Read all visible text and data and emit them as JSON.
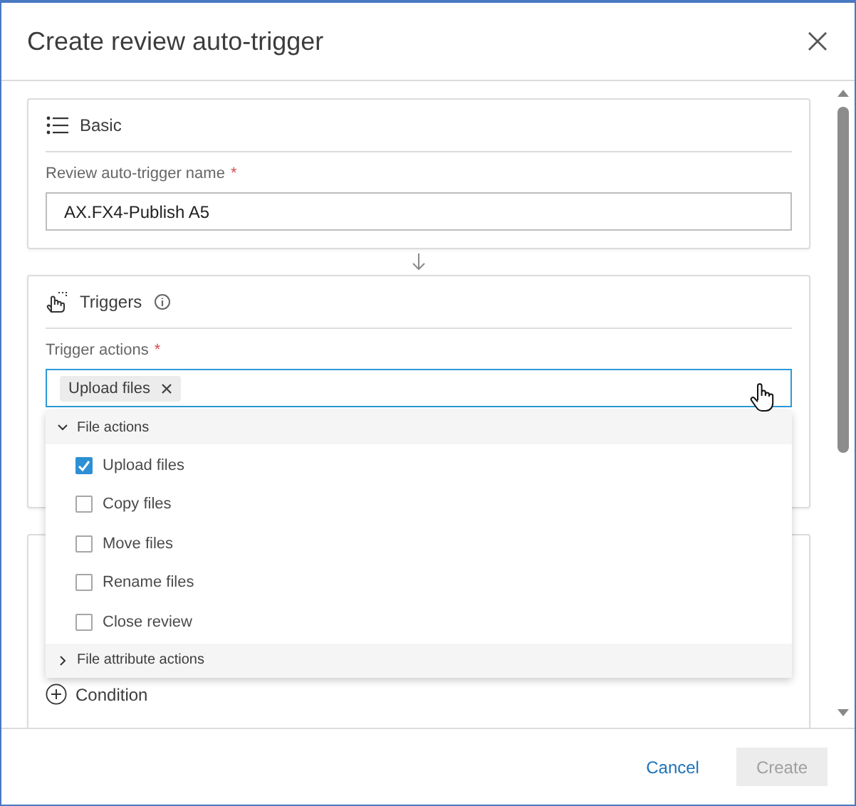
{
  "title": "Create review auto-trigger",
  "sections": [
    {
      "kind": "list",
      "title": "Basic",
      "field": {
        "label": "Review auto-trigger name",
        "required_mark": "*",
        "value": "AX.FX4-Publish A5",
        "focused": false
      }
    },
    {
      "kind": "hand",
      "title": "Triggers",
      "info": true,
      "field": {
        "label": "Trigger actions",
        "required_mark": "*",
        "chips": [
          "Upload files"
        ],
        "focused": true
      }
    },
    {
      "kind": "conditions",
      "add_label": "Condition"
    }
  ],
  "dropdown": {
    "groups": [
      {
        "label": "File actions",
        "expanded": true,
        "options": [
          {
            "label": "Upload files",
            "checked": true
          },
          {
            "label": "Copy files",
            "checked": false
          },
          {
            "label": "Move files",
            "checked": false
          },
          {
            "label": "Rename files",
            "checked": false
          },
          {
            "label": "Close review",
            "checked": false
          }
        ]
      },
      {
        "label": "File attribute actions",
        "expanded": false
      }
    ]
  },
  "buttons": [
    {
      "label": "Cancel",
      "kind": "link",
      "disabled": false
    },
    {
      "label": "Create",
      "kind": "primary",
      "disabled": true
    }
  ]
}
